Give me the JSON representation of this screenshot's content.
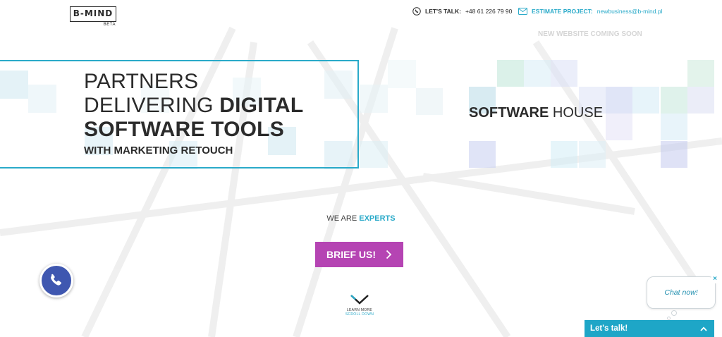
{
  "header": {
    "logo_text": "B-MIND",
    "logo_beta": "BETA",
    "phone_label": "LET'S TALK:",
    "phone_value": "+48 61 226 79 90",
    "email_label": "ESTIMATE PROJECT:",
    "email_value": "newbusiness@b-mind.pl",
    "coming_soon": "NEW WEBSITE COMING SOON"
  },
  "hero": {
    "line1": "PARTNERS",
    "line2_light": "DELIVERING",
    "line2_bold": "DIGITAL",
    "line3": "SOFTWARE TOOLS",
    "subline": "WITH MARKETING RETOUCH",
    "right_bold": "SOFTWARE",
    "right_light": "HOUSE"
  },
  "cta": {
    "experts_prefix": "WE ARE",
    "experts_accent": "EXPERTS",
    "brief_label": "BRIEF US!",
    "scroll_line1": "LEARN MORE",
    "scroll_line2": "SCROLL DOWN"
  },
  "widgets": {
    "call_icon": "phone-icon",
    "chat_bubble": "Chat now!",
    "chat_close": "×",
    "lets_talk": "Let's talk!"
  },
  "colors": {
    "accent_blue": "#2aaac9",
    "brief_purple": "#b544b3",
    "call_blue": "#3f57b0",
    "chat_bar": "#1ea6c7"
  }
}
